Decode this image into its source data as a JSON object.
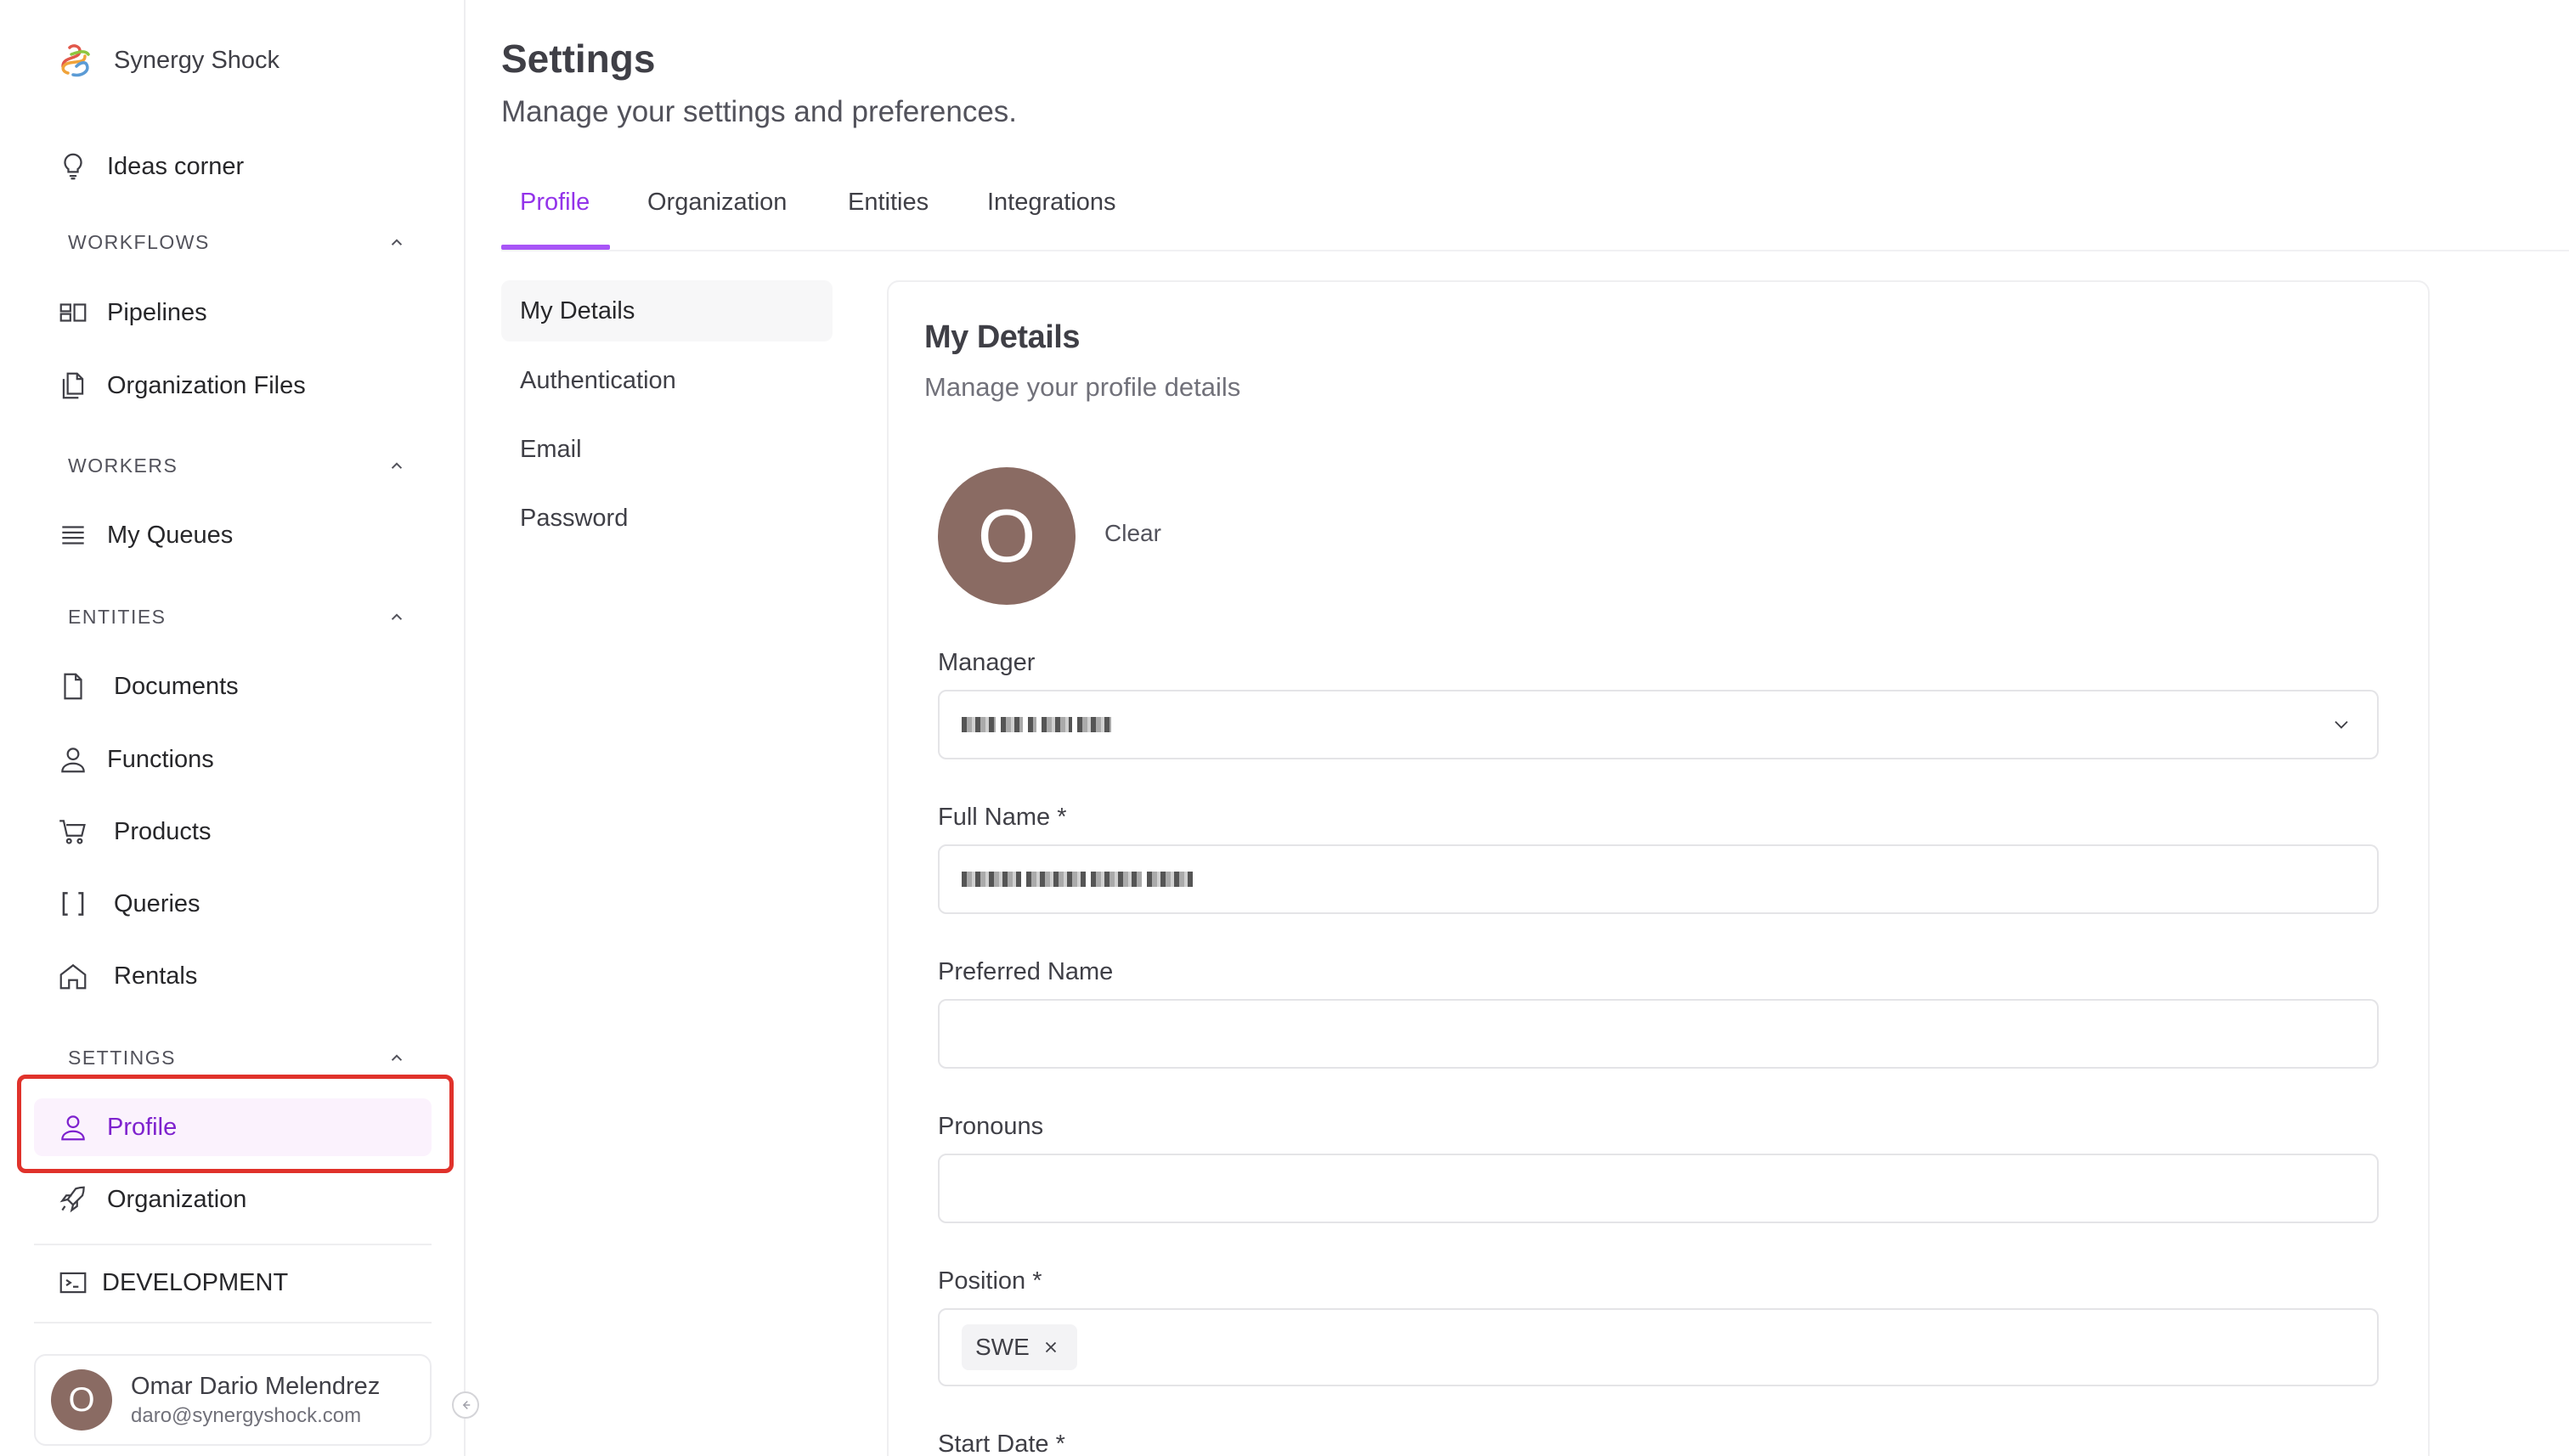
{
  "app": {
    "name": "Synergy Shock"
  },
  "sidebar": {
    "ideas": "Ideas corner",
    "sections": {
      "workflows": "WORKFLOWS",
      "workers": "WORKERS",
      "entities": "ENTITIES",
      "settings": "SETTINGS"
    },
    "items": {
      "pipelines": "Pipelines",
      "org_files": "Organization Files",
      "my_queues": "My Queues",
      "documents": "Documents",
      "functions": "Functions",
      "products": "Products",
      "queries": "Queries",
      "rentals": "Rentals",
      "profile": "Profile",
      "organization": "Organization",
      "development": "DEVELOPMENT"
    },
    "user": {
      "initial": "O",
      "name": "Omar Dario Melendrez",
      "email": "daro@synergyshock.com"
    }
  },
  "header": {
    "title": "Settings",
    "subtitle": "Manage your settings and preferences."
  },
  "tabs": [
    "Profile",
    "Organization",
    "Entities",
    "Integrations"
  ],
  "subnav": [
    "My Details",
    "Authentication",
    "Email",
    "Password"
  ],
  "details": {
    "title": "My Details",
    "subtitle": "Manage your profile details",
    "avatar_initial": "O",
    "clear_label": "Clear",
    "manager_label": "Manager",
    "full_name_label": "Full Name *",
    "preferred_name_label": "Preferred Name",
    "pronouns_label": "Pronouns",
    "position_label": "Position *",
    "position_tag": "SWE",
    "start_date_label": "Start Date *"
  },
  "colors": {
    "accent": "#9333ea",
    "active_bg": "#fbf2fd",
    "avatar": "#8a6b63",
    "highlight": "#e0322b"
  }
}
